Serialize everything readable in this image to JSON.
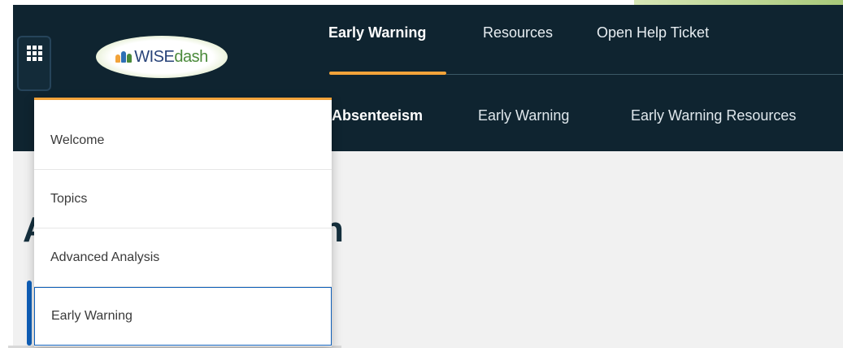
{
  "colors": {
    "header_bg": "#0f2430",
    "accent_orange": "#f2a33a",
    "selected_blue": "#0f5fb8",
    "content_bg": "#f1f1f1"
  },
  "header": {
    "apps_icon": "grid-icon",
    "logo_text_main": "WISE",
    "logo_text_accent": "dash",
    "nav": [
      {
        "label": "Early Warning",
        "active": true
      },
      {
        "label": "Resources",
        "active": false
      },
      {
        "label": "Open Help Ticket",
        "active": false
      }
    ]
  },
  "subnav": [
    {
      "label": "Absenteeism",
      "active": true
    },
    {
      "label": "Early Warning",
      "active": false
    },
    {
      "label": "Early Warning Resources",
      "active": false
    }
  ],
  "page": {
    "title_fragment_left": "A",
    "title_fragment_right": "n"
  },
  "app_menu": {
    "items": [
      {
        "label": "Welcome",
        "selected": false
      },
      {
        "label": "Topics",
        "selected": false
      },
      {
        "label": "Advanced Analysis",
        "selected": false
      },
      {
        "label": "Early Warning",
        "selected": true
      }
    ]
  }
}
